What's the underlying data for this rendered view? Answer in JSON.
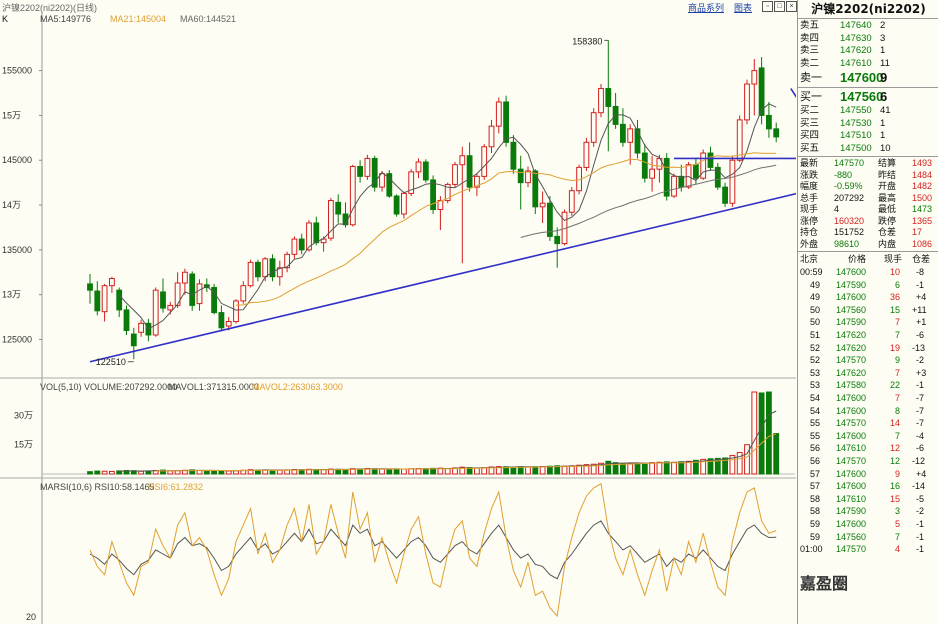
{
  "header": {
    "symbol_label": "沪镍2202(ni2202)(日线)",
    "k_label": "K",
    "ma5": "MA5:149776",
    "ma21": "MA21:145004",
    "ma60": "MA60:144521",
    "vol_line": "VOL(5,10) VOLUME:207292.0000",
    "mavol1": "MAVOL1:371315.0000",
    "mavol2": "MAVOL2:263063.3000",
    "rsi_line": "MARSI(10,6) RSI10:58.1465",
    "rsi6": "RSI6:61.2832",
    "toolbar_link1": "商品系列",
    "toolbar_link2": "图表"
  },
  "colors": {
    "up": "#d42020",
    "down": "#0a7a0a",
    "ma5": "#555555",
    "ma21": "#e0a030",
    "ma60": "#707070",
    "trend": "#3030c8",
    "vol_up": "#d42020",
    "vol_down": "#0a7a0a",
    "bg": "#fdfdf3"
  },
  "chart_data": {
    "type": "candlestick",
    "y_ticks": [
      "155000",
      "15万",
      "145000",
      "14万",
      "135000",
      "13万",
      "125000"
    ],
    "y_tick_values": [
      155000,
      150000,
      145000,
      140000,
      135000,
      130000,
      125000
    ],
    "vol_ticks": [
      "30万",
      "15万"
    ],
    "vol_tick_values": [
      300000,
      150000
    ],
    "rsi_ticks": [
      "20"
    ],
    "annotations": [
      {
        "text": "158380",
        "value": 158380
      },
      {
        "text": "122510",
        "value": 122510
      }
    ],
    "candles": [
      [
        131200,
        132300,
        129000,
        130500
      ],
      [
        130400,
        131500,
        127700,
        128200
      ],
      [
        128100,
        131200,
        127000,
        131000
      ],
      [
        131000,
        132000,
        130200,
        131800
      ],
      [
        130500,
        130800,
        127500,
        128300
      ],
      [
        128300,
        128800,
        125500,
        126000
      ],
      [
        125600,
        126300,
        122800,
        124300
      ],
      [
        125800,
        127200,
        125300,
        126800
      ],
      [
        126800,
        127300,
        124800,
        125500
      ],
      [
        125500,
        130800,
        125300,
        130500
      ],
      [
        130300,
        131800,
        128000,
        128500
      ],
      [
        128300,
        129200,
        127800,
        128800
      ],
      [
        128800,
        132500,
        128500,
        131300
      ],
      [
        131300,
        132900,
        130000,
        132500
      ],
      [
        132300,
        132600,
        128200,
        128800
      ],
      [
        129000,
        131700,
        128200,
        131200
      ],
      [
        131100,
        131800,
        130300,
        130800
      ],
      [
        130800,
        131200,
        127800,
        128000
      ],
      [
        128000,
        128800,
        125900,
        126300
      ],
      [
        126500,
        127500,
        126000,
        127000
      ],
      [
        127000,
        129500,
        126800,
        129300
      ],
      [
        129300,
        131500,
        129000,
        131000
      ],
      [
        131000,
        133900,
        130800,
        133600
      ],
      [
        133600,
        133900,
        131500,
        132000
      ],
      [
        132000,
        134200,
        131500,
        134000
      ],
      [
        134000,
        134500,
        131500,
        132000
      ],
      [
        132000,
        133800,
        131000,
        133000
      ],
      [
        133000,
        134800,
        132500,
        134500
      ],
      [
        134500,
        136500,
        134000,
        136200
      ],
      [
        136200,
        136800,
        134500,
        135000
      ],
      [
        135000,
        138300,
        134800,
        138000
      ],
      [
        138000,
        138700,
        135500,
        135800
      ],
      [
        135800,
        136500,
        134800,
        136200
      ],
      [
        136300,
        140800,
        136000,
        140500
      ],
      [
        140300,
        141200,
        138000,
        139000
      ],
      [
        139000,
        140300,
        137500,
        137800
      ],
      [
        137800,
        144500,
        137600,
        144300
      ],
      [
        144300,
        145000,
        142500,
        143200
      ],
      [
        143200,
        145600,
        142800,
        145200
      ],
      [
        145200,
        145500,
        141500,
        142000
      ],
      [
        142000,
        143800,
        141500,
        143500
      ],
      [
        143500,
        143900,
        140800,
        141000
      ],
      [
        141000,
        141200,
        138700,
        139000
      ],
      [
        139000,
        141500,
        138500,
        141300
      ],
      [
        141300,
        144000,
        141000,
        143700
      ],
      [
        143700,
        145200,
        143000,
        144800
      ],
      [
        144800,
        145100,
        142500,
        142800
      ],
      [
        142800,
        143300,
        139000,
        139500
      ],
      [
        139500,
        141000,
        137200,
        140500
      ],
      [
        140500,
        142500,
        140200,
        142300
      ],
      [
        142300,
        144800,
        142000,
        144500
      ],
      [
        144500,
        146500,
        133500,
        145500
      ],
      [
        145500,
        147000,
        141500,
        142000
      ],
      [
        142000,
        143500,
        141000,
        143200
      ],
      [
        143200,
        146800,
        142800,
        146500
      ],
      [
        146500,
        149500,
        145800,
        148800
      ],
      [
        148800,
        152000,
        148000,
        151500
      ],
      [
        151500,
        152200,
        146500,
        147000
      ],
      [
        147000,
        147800,
        143500,
        144000
      ],
      [
        144000,
        145500,
        139500,
        142500
      ],
      [
        142500,
        144300,
        142000,
        143800
      ],
      [
        143800,
        144000,
        139000,
        139800
      ],
      [
        139800,
        141500,
        138000,
        140200
      ],
      [
        140200,
        141000,
        136000,
        136500
      ],
      [
        136500,
        137500,
        133000,
        135700
      ],
      [
        135700,
        139500,
        135500,
        139200
      ],
      [
        139200,
        142000,
        138800,
        141600
      ],
      [
        141600,
        144500,
        141200,
        144200
      ],
      [
        144200,
        147500,
        143800,
        147000
      ],
      [
        147000,
        150800,
        146500,
        150300
      ],
      [
        150300,
        153500,
        149800,
        153000
      ],
      [
        153000,
        158380,
        146000,
        151000
      ],
      [
        151000,
        152500,
        148500,
        149000
      ],
      [
        149000,
        150800,
        146500,
        147000
      ],
      [
        147000,
        149000,
        144500,
        148500
      ],
      [
        148500,
        149500,
        145200,
        145800
      ],
      [
        145800,
        146800,
        142500,
        143000
      ],
      [
        143000,
        145500,
        141500,
        144000
      ],
      [
        144000,
        145600,
        142500,
        145200
      ],
      [
        145200,
        145800,
        140500,
        141000
      ],
      [
        141000,
        143500,
        140800,
        143200
      ],
      [
        143200,
        144500,
        141500,
        142000
      ],
      [
        142000,
        144800,
        141800,
        144500
      ],
      [
        144500,
        145300,
        142300,
        143000
      ],
      [
        143000,
        146200,
        142800,
        145800
      ],
      [
        145800,
        146500,
        143800,
        144200
      ],
      [
        144200,
        144700,
        141700,
        142000
      ],
      [
        142000,
        142500,
        139800,
        140200
      ],
      [
        140200,
        145500,
        139800,
        145000
      ],
      [
        145000,
        150000,
        144800,
        149500
      ],
      [
        149500,
        154000,
        149000,
        153500
      ],
      [
        153500,
        156300,
        150000,
        155000
      ],
      [
        155300,
        156500,
        149000,
        150000
      ],
      [
        150000,
        151500,
        147500,
        148500
      ],
      [
        148500,
        149200,
        147000,
        147600
      ]
    ],
    "volumes": [
      12000,
      15000,
      14000,
      13000,
      16000,
      18000,
      17000,
      14000,
      15000,
      18000,
      20000,
      16000,
      17000,
      19000,
      21000,
      18000,
      16000,
      17000,
      18000,
      16000,
      17000,
      19000,
      22000,
      20000,
      21000,
      20000,
      19000,
      21000,
      23000,
      22000,
      24000,
      23000,
      22000,
      25000,
      24000,
      23000,
      27000,
      26000,
      28000,
      27000,
      25000,
      24000,
      26000,
      25000,
      27000,
      28000,
      27000,
      29000,
      30000,
      28000,
      31000,
      35000,
      33000,
      30000,
      32000,
      36000,
      38000,
      37000,
      35000,
      38000,
      36000,
      37000,
      38000,
      40000,
      42000,
      40000,
      42000,
      45000,
      48000,
      50000,
      55000,
      65000,
      58000,
      52000,
      54000,
      56000,
      55000,
      58000,
      60000,
      62000,
      60000,
      63000,
      65000,
      70000,
      75000,
      78000,
      80000,
      82000,
      95000,
      110000,
      150000,
      420000,
      415000,
      420000,
      207292
    ],
    "rsi10": [
      50,
      48,
      45,
      50,
      47,
      43,
      40,
      45,
      47,
      52,
      50,
      48,
      55,
      58,
      54,
      55,
      53,
      48,
      42,
      44,
      50,
      54,
      58,
      52,
      55,
      50,
      52,
      56,
      60,
      56,
      62,
      55,
      56,
      62,
      58,
      54,
      64,
      60,
      62,
      54,
      56,
      52,
      48,
      52,
      56,
      58,
      54,
      48,
      46,
      50,
      54,
      56,
      52,
      50,
      55,
      60,
      64,
      58,
      52,
      48,
      50,
      45,
      44,
      40,
      38,
      46,
      50,
      55,
      60,
      64,
      66,
      60,
      56,
      52,
      54,
      50,
      46,
      48,
      50,
      44,
      48,
      46,
      50,
      48,
      52,
      48,
      44,
      42,
      50,
      56,
      62,
      64,
      60,
      58,
      58.1
    ],
    "rsi6": [
      52,
      44,
      40,
      56,
      46,
      36,
      30,
      44,
      46,
      62,
      54,
      48,
      64,
      70,
      54,
      58,
      52,
      40,
      30,
      38,
      56,
      64,
      72,
      50,
      60,
      46,
      52,
      64,
      72,
      56,
      74,
      50,
      56,
      74,
      60,
      48,
      80,
      62,
      70,
      46,
      58,
      46,
      36,
      50,
      62,
      68,
      50,
      36,
      34,
      50,
      62,
      66,
      48,
      44,
      60,
      72,
      80,
      58,
      42,
      34,
      46,
      30,
      32,
      24,
      20,
      44,
      58,
      70,
      78,
      82,
      84,
      62,
      48,
      40,
      52,
      40,
      30,
      42,
      52,
      32,
      48,
      40,
      56,
      46,
      60,
      46,
      34,
      30,
      56,
      70,
      80,
      82,
      66,
      60,
      61.3
    ],
    "trendlines": [
      {
        "from": [
          0,
          122510
        ],
        "to": [
          117,
          145200
        ]
      },
      {
        "from": [
          80,
          145200
        ],
        "to": [
          117,
          145200
        ]
      }
    ],
    "forecast_path": [
      [
        96,
        153000
      ],
      [
        100,
        148000
      ],
      [
        102,
        144500
      ],
      [
        105,
        143000
      ],
      [
        108,
        146000
      ],
      [
        110,
        142000
      ],
      [
        113,
        144800
      ]
    ]
  },
  "orderbook": {
    "title": "沪镍2202(ni2202)",
    "asks": [
      {
        "label": "卖五",
        "price": "147640",
        "vol": "2"
      },
      {
        "label": "卖四",
        "price": "147630",
        "vol": "3"
      },
      {
        "label": "卖三",
        "price": "147620",
        "vol": "1"
      },
      {
        "label": "卖二",
        "price": "147610",
        "vol": "11"
      },
      {
        "label": "卖一",
        "price": "147600",
        "vol": "9"
      }
    ],
    "bids": [
      {
        "label": "买一",
        "price": "147560",
        "vol": "6"
      },
      {
        "label": "买二",
        "price": "147550",
        "vol": "41"
      },
      {
        "label": "买三",
        "price": "147530",
        "vol": "1"
      },
      {
        "label": "买四",
        "price": "147510",
        "vol": "1"
      },
      {
        "label": "买五",
        "price": "147500",
        "vol": "10"
      }
    ]
  },
  "stats": [
    {
      "l1": "最新",
      "v1": "147570",
      "l2": "结算",
      "v2": "1493"
    },
    {
      "l1": "涨跌",
      "v1": "-880",
      "l2": "昨结",
      "v2": "1484"
    },
    {
      "l1": "幅度",
      "v1": "-0.59%",
      "l2": "开盘",
      "v2": "1482"
    },
    {
      "l1": "总手",
      "v1": "207292",
      "l2": "最高",
      "v2": "1500"
    },
    {
      "l1": "现手",
      "v1": "4",
      "l2": "最低",
      "v2": "1473"
    },
    {
      "l1": "涨停",
      "v1": "160320",
      "l2": "跌停",
      "v2": "1365"
    },
    {
      "l1": "持仓",
      "v1": "151752",
      "l2": "仓差",
      "v2": "17"
    },
    {
      "l1": "外盘",
      "v1": "98610",
      "l2": "内盘",
      "v2": "1086"
    }
  ],
  "ticks_header": {
    "c1": "北京",
    "c2": "价格",
    "c3": "现手",
    "c4": "仓差"
  },
  "ticks": [
    {
      "t": "00:59",
      "p": "147600",
      "v": "10",
      "d": "-8"
    },
    {
      "t": "49",
      "p": "147590",
      "v": "6",
      "d": "-1"
    },
    {
      "t": "49",
      "p": "147600",
      "v": "36",
      "d": "+4"
    },
    {
      "t": "50",
      "p": "147560",
      "v": "15",
      "d": "+11"
    },
    {
      "t": "50",
      "p": "147590",
      "v": "7",
      "d": "+1"
    },
    {
      "t": "51",
      "p": "147620",
      "v": "7",
      "d": "-6"
    },
    {
      "t": "52",
      "p": "147620",
      "v": "19",
      "d": "-13"
    },
    {
      "t": "52",
      "p": "147570",
      "v": "9",
      "d": "-2"
    },
    {
      "t": "53",
      "p": "147620",
      "v": "7",
      "d": "+3"
    },
    {
      "t": "53",
      "p": "147580",
      "v": "22",
      "d": "-1"
    },
    {
      "t": "54",
      "p": "147600",
      "v": "7",
      "d": "-7"
    },
    {
      "t": "54",
      "p": "147600",
      "v": "8",
      "d": "-7"
    },
    {
      "t": "55",
      "p": "147570",
      "v": "14",
      "d": "-7"
    },
    {
      "t": "55",
      "p": "147600",
      "v": "7",
      "d": "-4"
    },
    {
      "t": "56",
      "p": "147610",
      "v": "12",
      "d": "-6"
    },
    {
      "t": "56",
      "p": "147570",
      "v": "12",
      "d": "-12"
    },
    {
      "t": "57",
      "p": "147600",
      "v": "9",
      "d": "+4"
    },
    {
      "t": "57",
      "p": "147600",
      "v": "16",
      "d": "-14"
    },
    {
      "t": "58",
      "p": "147610",
      "v": "15",
      "d": "-5"
    },
    {
      "t": "58",
      "p": "147590",
      "v": "3",
      "d": "-2"
    },
    {
      "t": "59",
      "p": "147600",
      "v": "5",
      "d": "-1"
    },
    {
      "t": "59",
      "p": "147560",
      "v": "7",
      "d": "-1"
    },
    {
      "t": "01:00",
      "p": "147570",
      "v": "4",
      "d": "-1"
    }
  ],
  "watermark": "嘉盈圈"
}
